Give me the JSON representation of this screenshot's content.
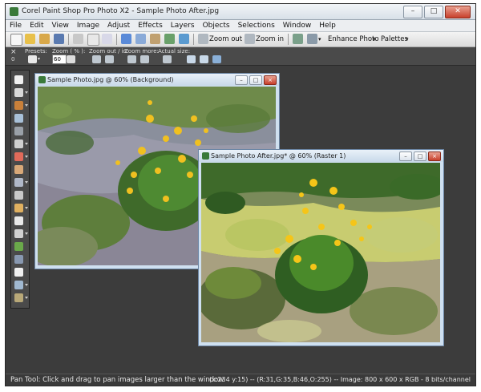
{
  "app": {
    "title": "Corel Paint Shop Pro Photo X2 - Sample Photo After.jpg",
    "window_buttons": {
      "minimize": "–",
      "maximize": "□",
      "close": "✕"
    }
  },
  "menu": [
    "File",
    "Edit",
    "View",
    "Image",
    "Adjust",
    "Effects",
    "Layers",
    "Objects",
    "Selections",
    "Window",
    "Help"
  ],
  "toolbar": {
    "zoom_out": "Zoom out",
    "zoom_in": "Zoom in",
    "enhance_photo": "Enhance Photo",
    "palettes": "Palettes"
  },
  "tool_options": {
    "close": "×",
    "zero": "0",
    "presets_label": "Presets:",
    "zoom_pct_label": "Zoom ( % ):",
    "zoom_value": "60",
    "zoom_out_in_label": "Zoom out / in:",
    "zoom_more_label": "Zoom more:",
    "actual_size_label": "Actual size:"
  },
  "windows": [
    {
      "title": "Sample Photo.jpg @ 60% (Background)"
    },
    {
      "title": "Sample Photo After.jpg* @ 60% (Raster 1)"
    }
  ],
  "window_controls": {
    "minimize": "–",
    "maximize": "□",
    "close": "×"
  },
  "status": {
    "left": "Pan Tool: Click and drag to pan images larger than the window.",
    "right": "(x:234 y:15) -- (R:31,G:35,B:46,O:255) -- Image: 800 x 600 x RGB - 8 bits/channel"
  },
  "colors": {
    "workspace": "#3c3c3c",
    "titlebar": "#d8e0e8",
    "window_frame": "#cfe0f0",
    "close_red": "#c8402c"
  }
}
